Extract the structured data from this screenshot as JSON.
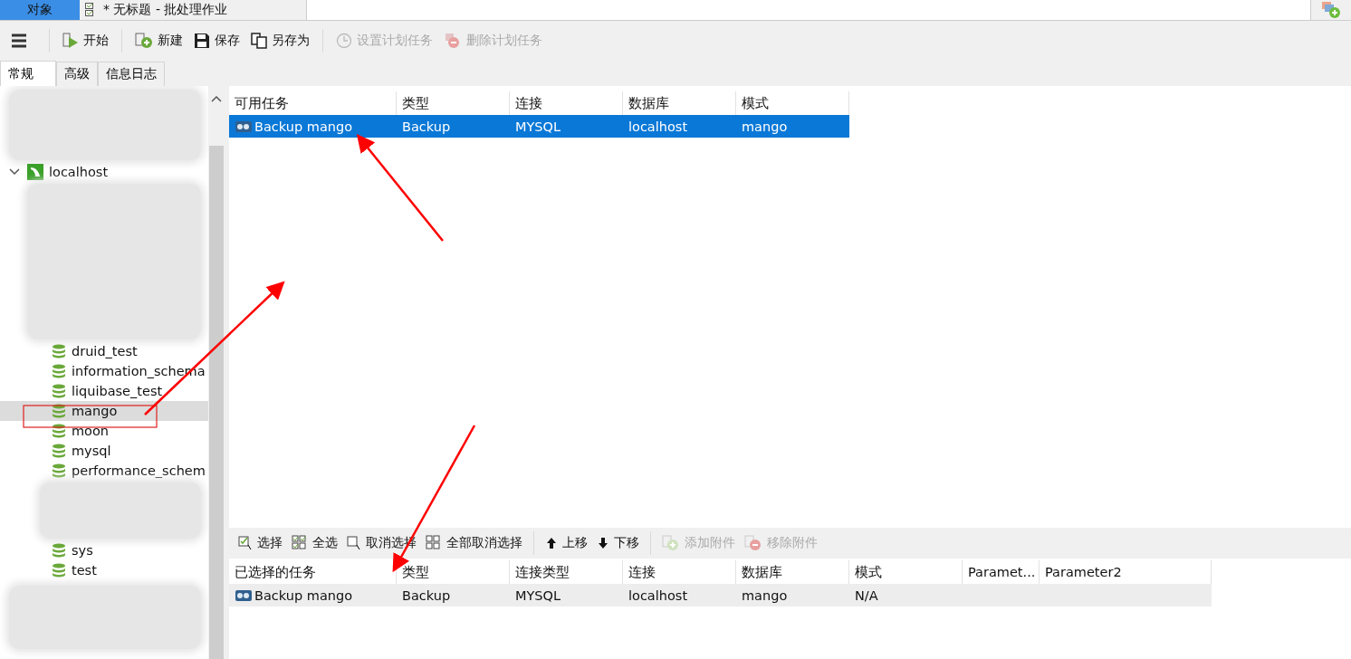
{
  "title_bar": {
    "object_tab": {
      "label": "对象",
      "selected": true
    },
    "document_tab": {
      "title": "* 无标题 - 批处理作业",
      "selected": false
    }
  },
  "toolbar": [
    {
      "label": "开始",
      "disabled": false
    },
    {
      "label": "新建",
      "disabled": false
    },
    {
      "label": "保存",
      "disabled": false
    },
    {
      "label": "另存为",
      "disabled": false
    },
    {
      "label": "设置计划任务",
      "disabled": true
    },
    {
      "label": "删除计划任务",
      "disabled": true
    }
  ],
  "side_tabs": [
    {
      "label": "常规",
      "selected": true
    },
    {
      "label": "高级",
      "selected": false
    },
    {
      "label": "信息日志",
      "selected": false
    }
  ],
  "tree": {
    "label": "localhost",
    "expanded": true,
    "children": [
      {
        "label": "druid_test",
        "selected": false
      },
      {
        "label": "information_schema",
        "selected": false
      },
      {
        "label": "liquibase_test",
        "selected": false
      },
      {
        "label": "mango",
        "selected": true
      },
      {
        "label": "moon",
        "selected": false
      },
      {
        "label": "mysql",
        "selected": false
      },
      {
        "label": "performance_schem",
        "selected": false
      },
      {
        "label": "sys",
        "selected": false
      },
      {
        "label": "test",
        "selected": false
      }
    ]
  },
  "available_tasks": {
    "columns": [
      "可用任务",
      "类型",
      "连接",
      "数据库",
      "模式"
    ],
    "rows": [
      {
        "cells": [
          "Backup mango",
          "Backup",
          "MYSQL",
          "localhost",
          "mango"
        ],
        "selected": true
      }
    ]
  },
  "task_toolbar": [
    {
      "label": "选择",
      "disabled": false
    },
    {
      "label": "全选",
      "disabled": false
    },
    {
      "label": "取消选择",
      "disabled": false
    },
    {
      "label": "全部取消选择",
      "disabled": false
    },
    {
      "label": "上移",
      "disabled": false
    },
    {
      "label": "下移",
      "disabled": false
    },
    {
      "label": "添加附件",
      "disabled": true
    },
    {
      "label": "移除附件",
      "disabled": true
    }
  ],
  "selected_tasks": {
    "columns": [
      "已选择的任务",
      "类型",
      "连接类型",
      "连接",
      "数据库",
      "模式",
      "Paramet...",
      "Parameter2"
    ],
    "rows": [
      {
        "cells": [
          "Backup mango",
          "Backup",
          "MYSQL",
          "localhost",
          "mango",
          "N/A",
          "",
          ""
        ],
        "selected": true
      }
    ]
  }
}
